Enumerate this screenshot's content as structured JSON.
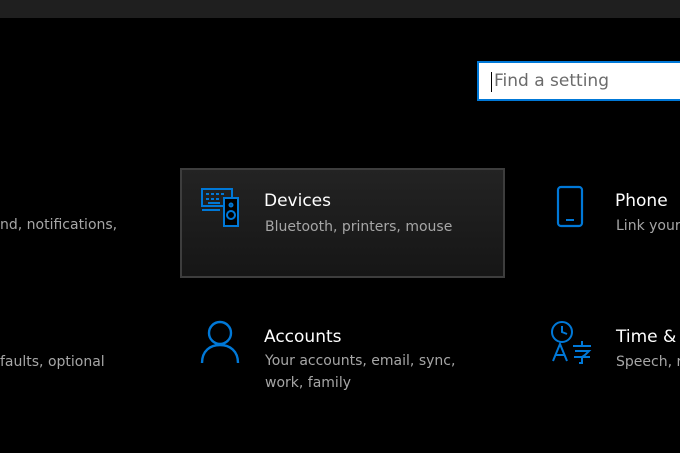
{
  "search": {
    "placeholder": "Find a setting"
  },
  "tiles": {
    "system_partial": {
      "desc": "nd, notifications,"
    },
    "devices": {
      "title": "Devices",
      "desc": "Bluetooth, printers, mouse",
      "icon": "keyboard-speaker-icon"
    },
    "phone": {
      "title": "Phone",
      "desc": "Link your",
      "icon": "phone-icon"
    },
    "apps_partial": {
      "desc": "faults, optional"
    },
    "accounts": {
      "title": "Accounts",
      "desc_line1": "Your accounts, email, sync,",
      "desc_line2": "work, family",
      "icon": "person-icon"
    },
    "time_language": {
      "title": "Time & L",
      "desc": "Speech, re",
      "icon": "time-language-icon"
    }
  },
  "colors": {
    "accent": "#0078d7",
    "background": "#000000",
    "title_text": "#ffffff",
    "desc_text": "#a6a6a6"
  }
}
